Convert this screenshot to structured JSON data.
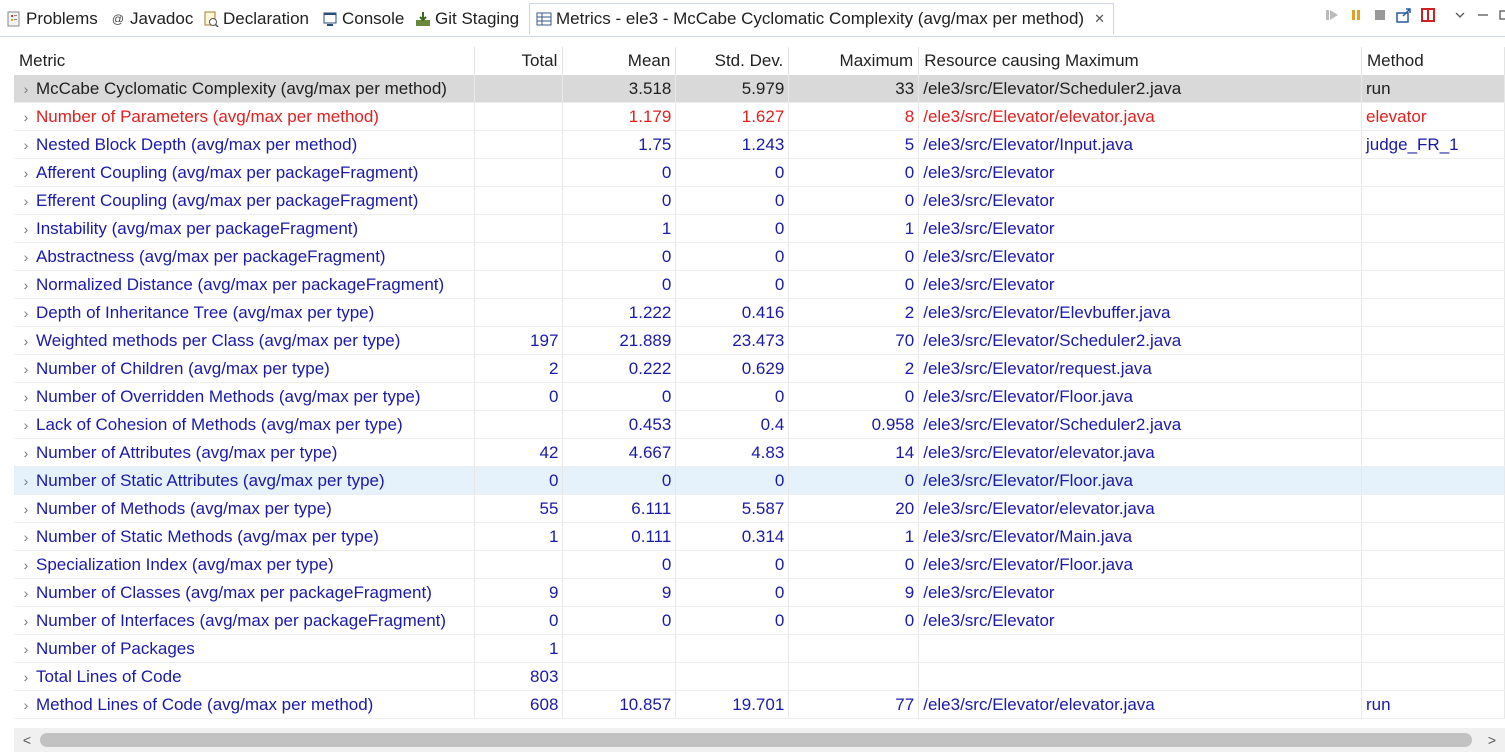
{
  "tabs": [
    {
      "label": "Problems",
      "icon": "problems-icon",
      "active": false
    },
    {
      "label": "Javadoc",
      "icon": "javadoc-icon",
      "active": false
    },
    {
      "label": "Declaration",
      "icon": "declaration-icon",
      "active": false
    },
    {
      "label": "Console",
      "icon": "console-icon",
      "active": false
    },
    {
      "label": "Git Staging",
      "icon": "git-staging-icon",
      "active": false
    },
    {
      "label": "Metrics - ele3 - McCabe Cyclomatic Complexity (avg/max per method)",
      "icon": "metrics-icon",
      "active": true
    }
  ],
  "toolbar_icons": [
    "run-icon",
    "pause-icon",
    "stop-icon",
    "export-icon",
    "layout-icon",
    "view-menu-icon",
    "minimize-icon",
    "maximize-icon"
  ],
  "table": {
    "columns": [
      "Metric",
      "Total",
      "Mean",
      "Std. Dev.",
      "Maximum",
      "Resource causing Maximum",
      "Method"
    ],
    "rows": [
      {
        "metric": "McCabe Cyclomatic Complexity (avg/max per method)",
        "total": "",
        "mean": "3.518",
        "std": "5.979",
        "max": "33",
        "resource": "/ele3/src/Elevator/Scheduler2.java",
        "method": "run",
        "state": "selected"
      },
      {
        "metric": "Number of Parameters (avg/max per method)",
        "total": "",
        "mean": "1.179",
        "std": "1.627",
        "max": "8",
        "resource": "/ele3/src/Elevator/elevator.java",
        "method": "elevator",
        "state": "warn"
      },
      {
        "metric": "Nested Block Depth (avg/max per method)",
        "total": "",
        "mean": "1.75",
        "std": "1.243",
        "max": "5",
        "resource": "/ele3/src/Elevator/Input.java",
        "method": "judge_FR_1",
        "state": ""
      },
      {
        "metric": "Afferent Coupling (avg/max per packageFragment)",
        "total": "",
        "mean": "0",
        "std": "0",
        "max": "0",
        "resource": "/ele3/src/Elevator",
        "method": "",
        "state": ""
      },
      {
        "metric": "Efferent Coupling (avg/max per packageFragment)",
        "total": "",
        "mean": "0",
        "std": "0",
        "max": "0",
        "resource": "/ele3/src/Elevator",
        "method": "",
        "state": ""
      },
      {
        "metric": "Instability (avg/max per packageFragment)",
        "total": "",
        "mean": "1",
        "std": "0",
        "max": "1",
        "resource": "/ele3/src/Elevator",
        "method": "",
        "state": ""
      },
      {
        "metric": "Abstractness (avg/max per packageFragment)",
        "total": "",
        "mean": "0",
        "std": "0",
        "max": "0",
        "resource": "/ele3/src/Elevator",
        "method": "",
        "state": ""
      },
      {
        "metric": "Normalized Distance (avg/max per packageFragment)",
        "total": "",
        "mean": "0",
        "std": "0",
        "max": "0",
        "resource": "/ele3/src/Elevator",
        "method": "",
        "state": ""
      },
      {
        "metric": "Depth of Inheritance Tree (avg/max per type)",
        "total": "",
        "mean": "1.222",
        "std": "0.416",
        "max": "2",
        "resource": "/ele3/src/Elevator/Elevbuffer.java",
        "method": "",
        "state": ""
      },
      {
        "metric": "Weighted methods per Class (avg/max per type)",
        "total": "197",
        "mean": "21.889",
        "std": "23.473",
        "max": "70",
        "resource": "/ele3/src/Elevator/Scheduler2.java",
        "method": "",
        "state": ""
      },
      {
        "metric": "Number of Children (avg/max per type)",
        "total": "2",
        "mean": "0.222",
        "std": "0.629",
        "max": "2",
        "resource": "/ele3/src/Elevator/request.java",
        "method": "",
        "state": ""
      },
      {
        "metric": "Number of Overridden Methods (avg/max per type)",
        "total": "0",
        "mean": "0",
        "std": "0",
        "max": "0",
        "resource": "/ele3/src/Elevator/Floor.java",
        "method": "",
        "state": ""
      },
      {
        "metric": "Lack of Cohesion of Methods (avg/max per type)",
        "total": "",
        "mean": "0.453",
        "std": "0.4",
        "max": "0.958",
        "resource": "/ele3/src/Elevator/Scheduler2.java",
        "method": "",
        "state": ""
      },
      {
        "metric": "Number of Attributes (avg/max per type)",
        "total": "42",
        "mean": "4.667",
        "std": "4.83",
        "max": "14",
        "resource": "/ele3/src/Elevator/elevator.java",
        "method": "",
        "state": ""
      },
      {
        "metric": "Number of Static Attributes (avg/max per type)",
        "total": "0",
        "mean": "0",
        "std": "0",
        "max": "0",
        "resource": "/ele3/src/Elevator/Floor.java",
        "method": "",
        "state": "hover"
      },
      {
        "metric": "Number of Methods (avg/max per type)",
        "total": "55",
        "mean": "6.111",
        "std": "5.587",
        "max": "20",
        "resource": "/ele3/src/Elevator/elevator.java",
        "method": "",
        "state": ""
      },
      {
        "metric": "Number of Static Methods (avg/max per type)",
        "total": "1",
        "mean": "0.111",
        "std": "0.314",
        "max": "1",
        "resource": "/ele3/src/Elevator/Main.java",
        "method": "",
        "state": ""
      },
      {
        "metric": "Specialization Index (avg/max per type)",
        "total": "",
        "mean": "0",
        "std": "0",
        "max": "0",
        "resource": "/ele3/src/Elevator/Floor.java",
        "method": "",
        "state": ""
      },
      {
        "metric": "Number of Classes (avg/max per packageFragment)",
        "total": "9",
        "mean": "9",
        "std": "0",
        "max": "9",
        "resource": "/ele3/src/Elevator",
        "method": "",
        "state": ""
      },
      {
        "metric": "Number of Interfaces (avg/max per packageFragment)",
        "total": "0",
        "mean": "0",
        "std": "0",
        "max": "0",
        "resource": "/ele3/src/Elevator",
        "method": "",
        "state": ""
      },
      {
        "metric": "Number of Packages",
        "total": "1",
        "mean": "",
        "std": "",
        "max": "",
        "resource": "",
        "method": "",
        "state": ""
      },
      {
        "metric": "Total Lines of Code",
        "total": "803",
        "mean": "",
        "std": "",
        "max": "",
        "resource": "",
        "method": "",
        "state": ""
      },
      {
        "metric": "Method Lines of Code (avg/max per method)",
        "total": "608",
        "mean": "10.857",
        "std": "19.701",
        "max": "77",
        "resource": "/ele3/src/Elevator/elevator.java",
        "method": "run",
        "state": ""
      }
    ]
  },
  "scrollbar": {
    "left_arrow": "<",
    "right_arrow": ">"
  }
}
